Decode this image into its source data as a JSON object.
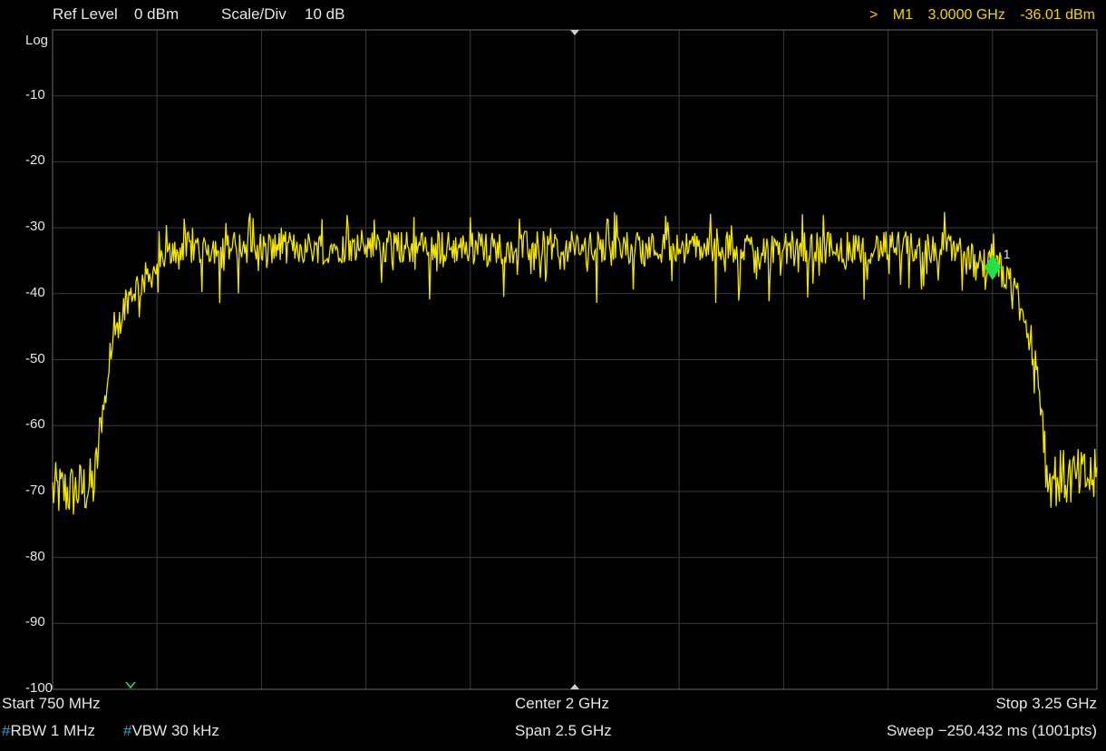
{
  "header": {
    "ref_level_label": "Ref Level",
    "ref_level_value": "0 dBm",
    "scale_label": "Scale/Div",
    "scale_value": "10 dB"
  },
  "marker_readout": {
    "prefix": ">",
    "name": "M1",
    "freq": "3.0000 GHz",
    "level": "-36.01 dBm"
  },
  "y_axis": {
    "scale_word": "Log",
    "ticks": [
      "-10",
      "-20",
      "-30",
      "-40",
      "-50",
      "-60",
      "-70",
      "-80",
      "-90",
      "-100"
    ]
  },
  "footer": {
    "start_label": "Start",
    "start_value": "750 MHz",
    "center_label": "Center",
    "center_value": "2 GHz",
    "stop_label": "Stop",
    "stop_value": "3.25 GHz",
    "rbw_hash": "#",
    "rbw_label": "RBW",
    "rbw_value": "1 MHz",
    "vbw_hash": "#",
    "vbw_label": "VBW",
    "vbw_value": "30 kHz",
    "span_label": "Span",
    "span_value": "2.5 GHz",
    "sweep_label": "Sweep",
    "sweep_value": "−250.432 ms (1001pts)"
  },
  "colors": {
    "trace": "#f2e600",
    "marker": "#22e04a",
    "grid": "#3a3a3a",
    "frame": "#6a6a6a",
    "label": "#e6e6e6",
    "readout": "#f0d21e",
    "hash_blue": "#2aa2e6"
  },
  "chart_data": {
    "type": "line",
    "x_unit": "GHz",
    "y_unit": "dBm",
    "xlim": [
      0.75,
      3.25
    ],
    "ylim": [
      -100,
      0
    ],
    "grid": true,
    "points": 1001,
    "series": [
      {
        "name": "",
        "x": [
          0.75,
          0.8,
          0.85,
          0.875,
          0.9,
          0.925,
          0.95,
          1.0,
          1.05,
          1.1,
          1.2,
          1.3,
          1.4,
          1.5,
          1.6,
          1.7,
          1.8,
          1.9,
          2.0,
          2.1,
          2.2,
          2.3,
          2.4,
          2.5,
          2.6,
          2.7,
          2.8,
          2.9,
          2.95,
          3.0,
          3.04,
          3.07,
          3.1,
          3.12,
          3.13,
          3.2,
          3.25
        ],
        "y": [
          -70,
          -70,
          -69,
          -55,
          -47,
          -41,
          -39,
          -36,
          -33,
          -33,
          -33,
          -33,
          -33,
          -33,
          -33,
          -33,
          -33,
          -33,
          -33,
          -33,
          -33,
          -33,
          -33,
          -33,
          -33,
          -33,
          -33,
          -33,
          -34,
          -36,
          -38,
          -43,
          -50,
          -58,
          -68,
          -68,
          -68
        ]
      }
    ],
    "markers": [
      {
        "label": "1",
        "x": 3.0,
        "y": -36.01
      }
    ],
    "ref_level_dbm": 0,
    "scale_db_per_div": 10
  }
}
